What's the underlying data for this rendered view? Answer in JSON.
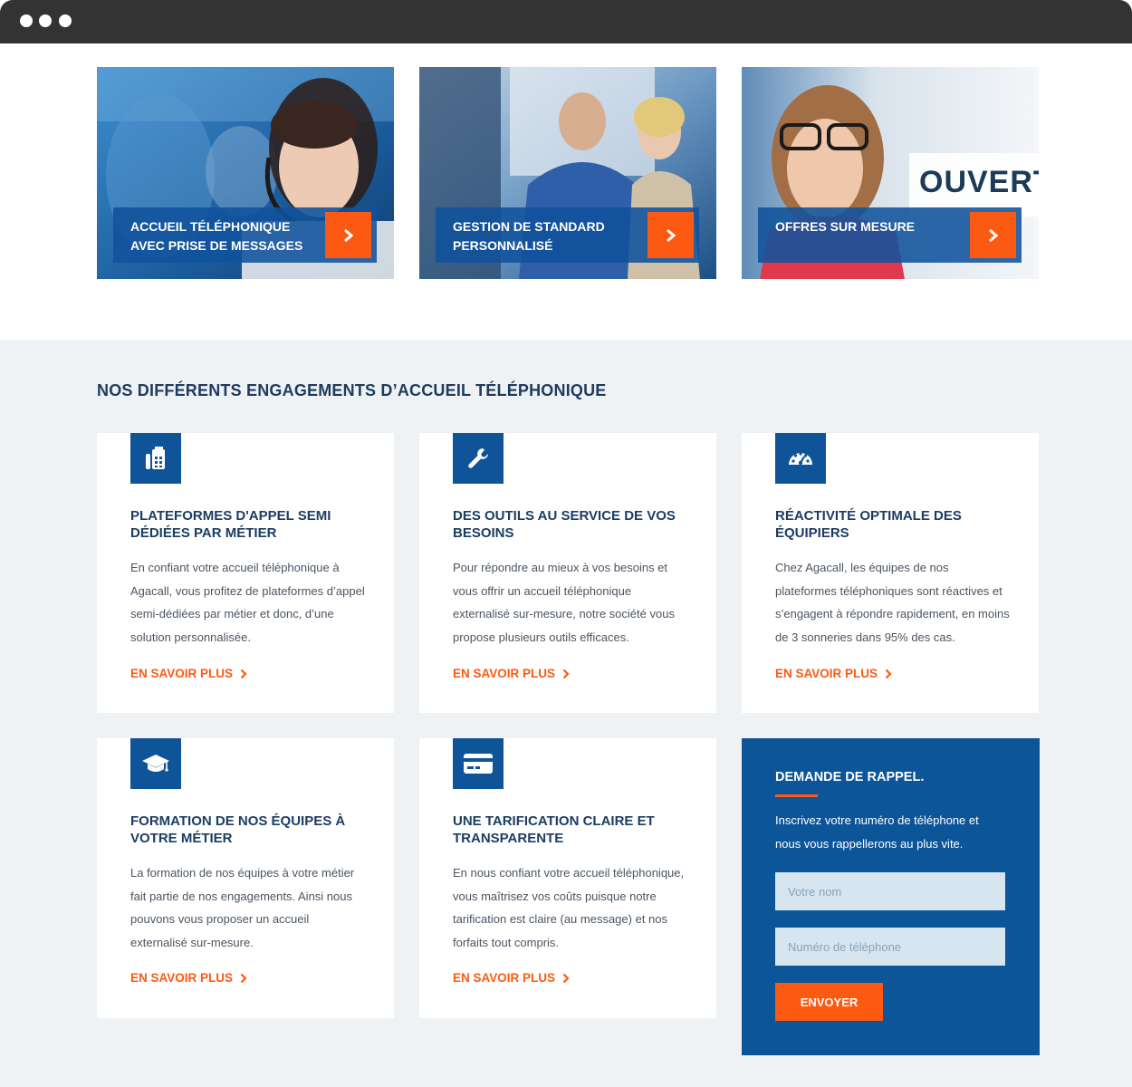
{
  "window": {
    "dots": [
      "window-dot-1",
      "window-dot-2",
      "window-dot-3"
    ]
  },
  "hero_cards": [
    {
      "label": "ACCUEIL TÉLÉPHONIQUE AVEC PRISE DE MESSAGES",
      "icon": "chevron-right-icon"
    },
    {
      "label": "GESTION DE STANDARD PERSONNALISÉ",
      "icon": "chevron-right-icon"
    },
    {
      "label": "OFFRES SUR MESURE",
      "sign_text": "OUVERT",
      "icon": "chevron-right-icon"
    }
  ],
  "section": {
    "title": "NOS DIFFÉRENTS ENGAGEMENTS D’ACCUEIL TÉLÉPHONIQUE"
  },
  "features": [
    {
      "icon": "fax-icon",
      "title": "PLATEFORMES D'APPEL SEMI DÉDIÉES PAR MÉTIER",
      "text": "En confiant votre accueil téléphonique à Agacall, vous profitez de plateformes d’appel semi-dédiées par métier et donc, d’une solution personnalisée.",
      "link": "EN SAVOIR PLUS"
    },
    {
      "icon": "wrench-icon",
      "title": "DES OUTILS AU SERVICE DE VOS BESOINS",
      "text": "Pour répondre au mieux à vos besoins et vous offrir un accueil téléphonique externalisé sur-mesure, notre société vous propose plusieurs outils efficaces.",
      "link": "EN SAVOIR PLUS"
    },
    {
      "icon": "gauge-icon",
      "title": "RÉACTIVITÉ OPTIMALE DES ÉQUIPIERS",
      "text": "Chez Agacall, les équipes de nos plateformes téléphoniques sont réactives et s’engagent à répondre rapidement, en moins de 3 sonneries dans 95% des cas.",
      "link": "EN SAVOIR PLUS"
    },
    {
      "icon": "graduation-cap-icon",
      "title": "FORMATION DE NOS ÉQUIPES À VOTRE MÉTIER",
      "text": "La formation de nos équipes à votre métier fait partie de nos engagements. Ainsi nous pouvons vous proposer un accueil externalisé sur-mesure.",
      "link": "EN SAVOIR PLUS"
    },
    {
      "icon": "credit-card-icon",
      "title": "UNE TARIFICATION CLAIRE ET TRANSPARENTE",
      "text": "En nous confiant votre accueil téléphonique, vous maîtrisez vos coûts puisque notre tarification est claire (au message) et nos forfaits tout compris.",
      "link": "EN SAVOIR PLUS"
    }
  ],
  "callback": {
    "title": "DEMANDE DE RAPPEL.",
    "text": "Inscrivez votre numéro de téléphone et nous vous rappellerons au plus vite.",
    "name_placeholder": "Votre nom",
    "name_value": "",
    "phone_placeholder": "Numéro de téléphone",
    "phone_value": "",
    "submit": "ENVOYER"
  },
  "colors": {
    "primary_blue": "#0f5499",
    "accent_orange": "#fc5a12",
    "title_navy": "#1c3d63",
    "section_bg": "#eff2f5"
  }
}
